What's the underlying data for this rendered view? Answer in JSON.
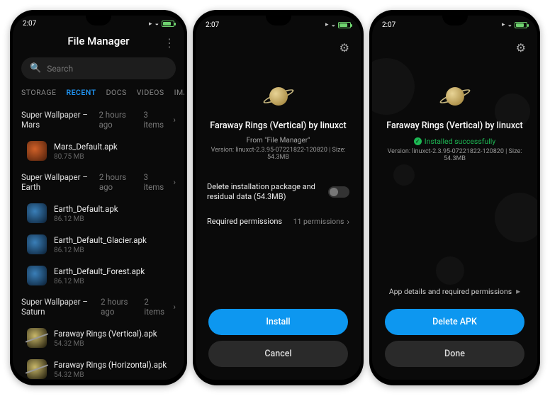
{
  "status": {
    "time": "2:07"
  },
  "fileManager": {
    "title": "File Manager",
    "searchPlaceholder": "Search",
    "tabs": [
      "STORAGE",
      "RECENT",
      "DOCS",
      "VIDEOS",
      "IMAG"
    ],
    "activeTab": 1,
    "sections": [
      {
        "title": "Super Wallpaper – Mars",
        "age": "2 hours ago",
        "count": "3 items",
        "files": [
          {
            "name": "Mars_Default.apk",
            "size": "80.75 MB",
            "icon": "mars"
          }
        ]
      },
      {
        "title": "Super Wallpaper – Earth",
        "age": "2 hours ago",
        "count": "3 items",
        "files": [
          {
            "name": "Earth_Default.apk",
            "size": "86.12 MB",
            "icon": "earth"
          },
          {
            "name": "Earth_Default_Glacier.apk",
            "size": "86.12 MB",
            "icon": "earth"
          },
          {
            "name": "Earth_Default_Forest.apk",
            "size": "86.12 MB",
            "icon": "earth"
          }
        ]
      },
      {
        "title": "Super Wallpaper – Saturn",
        "age": "2 hours ago",
        "count": "2 items",
        "files": [
          {
            "name": "Faraway Rings (Vertical).apk",
            "size": "54.32 MB",
            "icon": "saturn"
          },
          {
            "name": "Faraway Rings (Horizontal).apk",
            "size": "54.32 MB",
            "icon": "saturn"
          }
        ]
      }
    ]
  },
  "installer": {
    "appTitle": "Faraway Rings (Vertical) by linuxct",
    "fromLine": "From \"File Manager\"",
    "versionLine": "Version: linuxct-2.3.95-07221822-120820 | Size: 54.3MB",
    "deleteOption": "Delete installation package and residual data (54.3MB)",
    "permissionsLabel": "Required permissions",
    "permissionsCount": "11 permissions",
    "installBtn": "Install",
    "cancelBtn": "Cancel"
  },
  "installed": {
    "appTitle": "Faraway Rings (Vertical) by linuxct",
    "successLine": "Installed successfully",
    "versionLine": "Version: linuxct-2.3.95-07221822-120820 | Size: 54.3MB",
    "detailsLine": "App details and required permissions",
    "deleteBtn": "Delete APK",
    "doneBtn": "Done"
  }
}
